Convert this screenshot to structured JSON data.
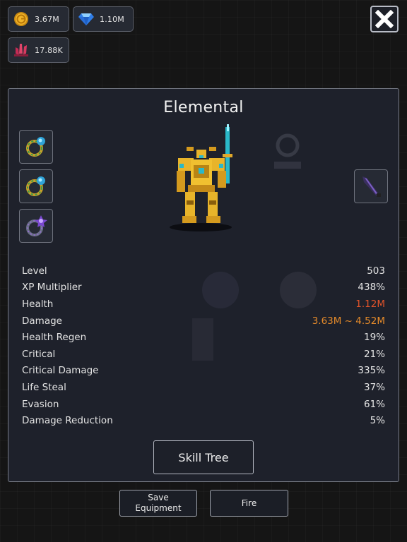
{
  "currencies": {
    "gold": "3.67M",
    "gems": "1.10M",
    "crystals": "17.88K"
  },
  "hero": {
    "name": "Elemental"
  },
  "stats": [
    {
      "label": "Level",
      "value": "503",
      "tone": "normal"
    },
    {
      "label": "XP Multiplier",
      "value": "438%",
      "tone": "normal"
    },
    {
      "label": "Health",
      "value": "1.12M",
      "tone": "red"
    },
    {
      "label": "Damage",
      "value": "3.63M ~ 4.52M",
      "tone": "orange"
    },
    {
      "label": "Health Regen",
      "value": "19%",
      "tone": "normal"
    },
    {
      "label": "Critical",
      "value": "21%",
      "tone": "normal"
    },
    {
      "label": "Critical Damage",
      "value": "335%",
      "tone": "normal"
    },
    {
      "label": "Life Steal",
      "value": "37%",
      "tone": "normal"
    },
    {
      "label": "Evasion",
      "value": "61%",
      "tone": "normal"
    },
    {
      "label": "Damage Reduction",
      "value": "5%",
      "tone": "normal"
    }
  ],
  "buttons": {
    "skill_tree": "Skill Tree",
    "save_equipment_line1": "Save",
    "save_equipment_line2": "Equipment",
    "fire": "Fire"
  },
  "colors": {
    "value_red": "#e0532a",
    "value_orange": "#e48a2a",
    "panel_bg": "#1e212b"
  }
}
